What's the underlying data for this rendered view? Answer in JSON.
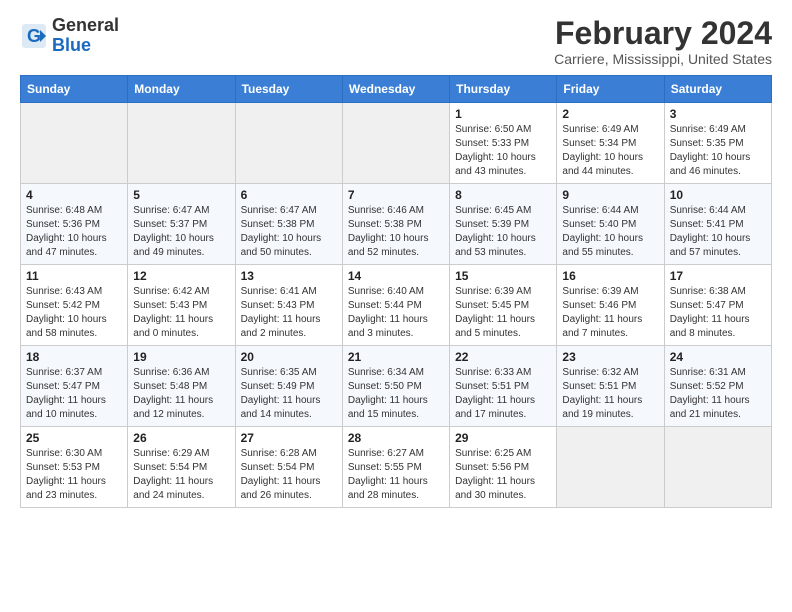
{
  "logo": {
    "line1": "General",
    "line2": "Blue"
  },
  "title": "February 2024",
  "location": "Carriere, Mississippi, United States",
  "days_of_week": [
    "Sunday",
    "Monday",
    "Tuesday",
    "Wednesday",
    "Thursday",
    "Friday",
    "Saturday"
  ],
  "weeks": [
    [
      {
        "day": "",
        "info": ""
      },
      {
        "day": "",
        "info": ""
      },
      {
        "day": "",
        "info": ""
      },
      {
        "day": "",
        "info": ""
      },
      {
        "day": "1",
        "info": "Sunrise: 6:50 AM\nSunset: 5:33 PM\nDaylight: 10 hours\nand 43 minutes."
      },
      {
        "day": "2",
        "info": "Sunrise: 6:49 AM\nSunset: 5:34 PM\nDaylight: 10 hours\nand 44 minutes."
      },
      {
        "day": "3",
        "info": "Sunrise: 6:49 AM\nSunset: 5:35 PM\nDaylight: 10 hours\nand 46 minutes."
      }
    ],
    [
      {
        "day": "4",
        "info": "Sunrise: 6:48 AM\nSunset: 5:36 PM\nDaylight: 10 hours\nand 47 minutes."
      },
      {
        "day": "5",
        "info": "Sunrise: 6:47 AM\nSunset: 5:37 PM\nDaylight: 10 hours\nand 49 minutes."
      },
      {
        "day": "6",
        "info": "Sunrise: 6:47 AM\nSunset: 5:38 PM\nDaylight: 10 hours\nand 50 minutes."
      },
      {
        "day": "7",
        "info": "Sunrise: 6:46 AM\nSunset: 5:38 PM\nDaylight: 10 hours\nand 52 minutes."
      },
      {
        "day": "8",
        "info": "Sunrise: 6:45 AM\nSunset: 5:39 PM\nDaylight: 10 hours\nand 53 minutes."
      },
      {
        "day": "9",
        "info": "Sunrise: 6:44 AM\nSunset: 5:40 PM\nDaylight: 10 hours\nand 55 minutes."
      },
      {
        "day": "10",
        "info": "Sunrise: 6:44 AM\nSunset: 5:41 PM\nDaylight: 10 hours\nand 57 minutes."
      }
    ],
    [
      {
        "day": "11",
        "info": "Sunrise: 6:43 AM\nSunset: 5:42 PM\nDaylight: 10 hours\nand 58 minutes."
      },
      {
        "day": "12",
        "info": "Sunrise: 6:42 AM\nSunset: 5:43 PM\nDaylight: 11 hours\nand 0 minutes."
      },
      {
        "day": "13",
        "info": "Sunrise: 6:41 AM\nSunset: 5:43 PM\nDaylight: 11 hours\nand 2 minutes."
      },
      {
        "day": "14",
        "info": "Sunrise: 6:40 AM\nSunset: 5:44 PM\nDaylight: 11 hours\nand 3 minutes."
      },
      {
        "day": "15",
        "info": "Sunrise: 6:39 AM\nSunset: 5:45 PM\nDaylight: 11 hours\nand 5 minutes."
      },
      {
        "day": "16",
        "info": "Sunrise: 6:39 AM\nSunset: 5:46 PM\nDaylight: 11 hours\nand 7 minutes."
      },
      {
        "day": "17",
        "info": "Sunrise: 6:38 AM\nSunset: 5:47 PM\nDaylight: 11 hours\nand 8 minutes."
      }
    ],
    [
      {
        "day": "18",
        "info": "Sunrise: 6:37 AM\nSunset: 5:47 PM\nDaylight: 11 hours\nand 10 minutes."
      },
      {
        "day": "19",
        "info": "Sunrise: 6:36 AM\nSunset: 5:48 PM\nDaylight: 11 hours\nand 12 minutes."
      },
      {
        "day": "20",
        "info": "Sunrise: 6:35 AM\nSunset: 5:49 PM\nDaylight: 11 hours\nand 14 minutes."
      },
      {
        "day": "21",
        "info": "Sunrise: 6:34 AM\nSunset: 5:50 PM\nDaylight: 11 hours\nand 15 minutes."
      },
      {
        "day": "22",
        "info": "Sunrise: 6:33 AM\nSunset: 5:51 PM\nDaylight: 11 hours\nand 17 minutes."
      },
      {
        "day": "23",
        "info": "Sunrise: 6:32 AM\nSunset: 5:51 PM\nDaylight: 11 hours\nand 19 minutes."
      },
      {
        "day": "24",
        "info": "Sunrise: 6:31 AM\nSunset: 5:52 PM\nDaylight: 11 hours\nand 21 minutes."
      }
    ],
    [
      {
        "day": "25",
        "info": "Sunrise: 6:30 AM\nSunset: 5:53 PM\nDaylight: 11 hours\nand 23 minutes."
      },
      {
        "day": "26",
        "info": "Sunrise: 6:29 AM\nSunset: 5:54 PM\nDaylight: 11 hours\nand 24 minutes."
      },
      {
        "day": "27",
        "info": "Sunrise: 6:28 AM\nSunset: 5:54 PM\nDaylight: 11 hours\nand 26 minutes."
      },
      {
        "day": "28",
        "info": "Sunrise: 6:27 AM\nSunset: 5:55 PM\nDaylight: 11 hours\nand 28 minutes."
      },
      {
        "day": "29",
        "info": "Sunrise: 6:25 AM\nSunset: 5:56 PM\nDaylight: 11 hours\nand 30 minutes."
      },
      {
        "day": "",
        "info": ""
      },
      {
        "day": "",
        "info": ""
      }
    ]
  ]
}
